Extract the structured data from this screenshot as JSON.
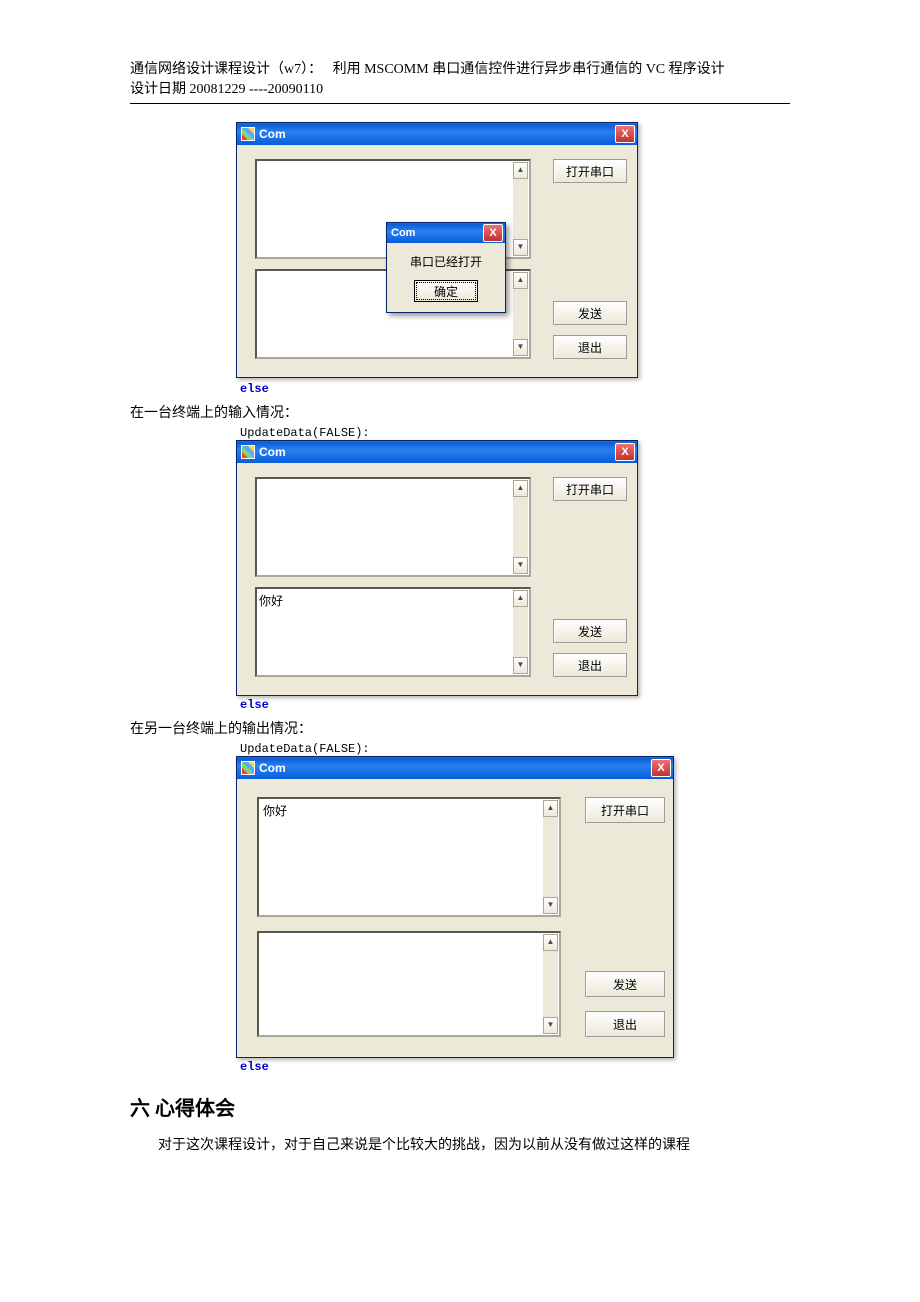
{
  "header": {
    "line1": "通信网络设计课程设计（w7）：   利用 MSCOMM 串口通信控件进行异步串行通信的 VC 程序设计",
    "line2": "设计日期 20081229 ----20090110"
  },
  "code": {
    "else": "else",
    "update": "UpdateData(FALSE):"
  },
  "dialog1": {
    "title": "Com",
    "close": "X",
    "btn_open": "打开串口",
    "btn_send": "发送",
    "btn_exit": "退出",
    "textbox1": "",
    "textbox2": "",
    "msgbox": {
      "title": "Com",
      "close": "X",
      "text": "串口已经打开",
      "ok": "确定"
    }
  },
  "caption1": "在一台终端上的输入情况：",
  "dialog2": {
    "title": "Com",
    "close": "X",
    "btn_open": "打开串口",
    "btn_send": "发送",
    "btn_exit": "退出",
    "textbox1": "",
    "textbox2": "你好"
  },
  "caption2": "在另一台终端上的输出情况：",
  "dialog3": {
    "title": "Com",
    "close": "X",
    "btn_open": "打开串口",
    "btn_send": "发送",
    "btn_exit": "退出",
    "textbox1": "你好",
    "textbox2": ""
  },
  "section_head": "六 心得体会",
  "paragraph": "对于这次课程设计，对于自己来说是个比较大的挑战，因为以前从没有做过这样的课程"
}
